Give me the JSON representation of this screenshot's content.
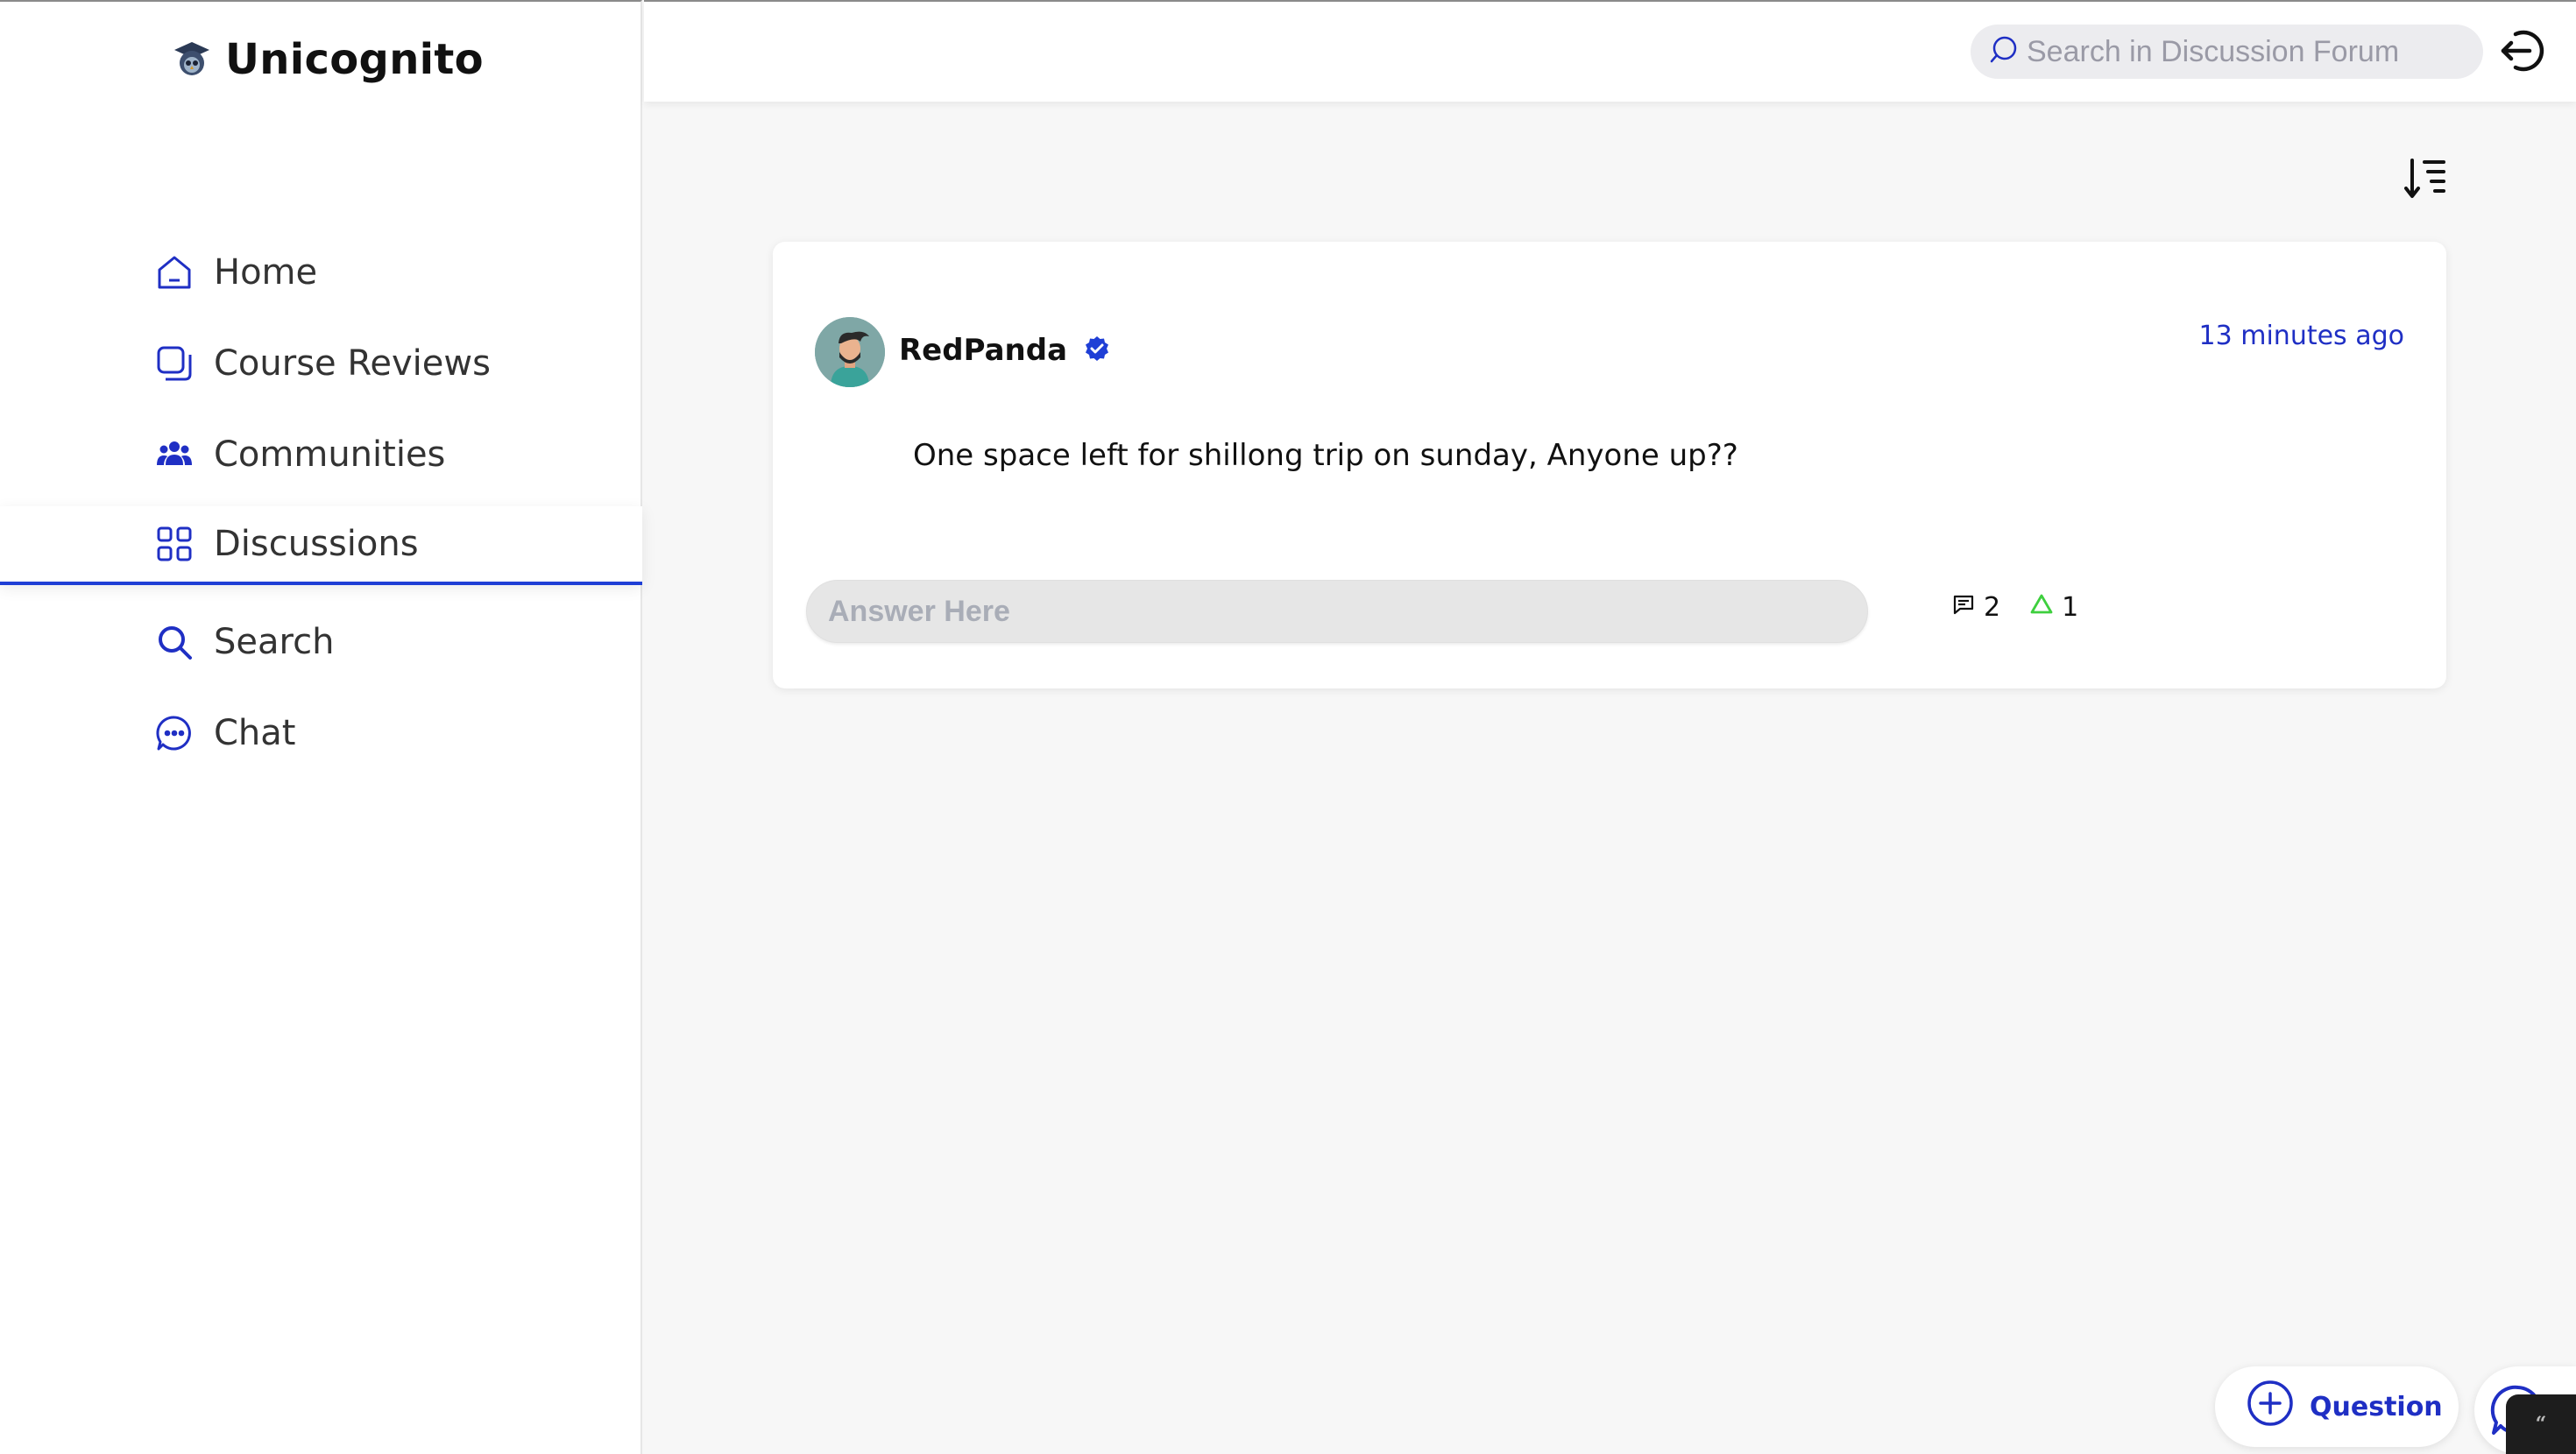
{
  "app": {
    "name": "Unicognito",
    "logo_icon": "graduation-owl-logo"
  },
  "sidebar": {
    "items": [
      {
        "label": "Home",
        "icon": "home-icon",
        "active": false
      },
      {
        "label": "Course Reviews",
        "icon": "copy-icon",
        "active": false
      },
      {
        "label": "Communities",
        "icon": "users-icon",
        "active": false
      },
      {
        "label": "Discussions",
        "icon": "grid-icon",
        "active": true
      },
      {
        "label": "Search",
        "icon": "search-icon",
        "active": false
      },
      {
        "label": "Chat",
        "icon": "chat-bubble-icon",
        "active": false
      }
    ]
  },
  "header": {
    "search_placeholder": "Search in Discussion Forum",
    "logout_icon": "logout-icon"
  },
  "toolbar": {
    "sort_icon": "sort-descending-icon"
  },
  "post": {
    "author": "RedPanda",
    "verified": true,
    "timestamp": "13 minutes ago",
    "text": "One space left for shillong trip on sunday, Anyone up??",
    "answer_placeholder": "Answer Here",
    "comment_count": "2",
    "upvote_count": "1"
  },
  "actions": {
    "question_label": "Question"
  },
  "colors": {
    "accent": "#1f2fc4",
    "active_underline": "#1f3fd6",
    "upvote": "#3ecf3e",
    "verified": "#1f3fd6"
  }
}
